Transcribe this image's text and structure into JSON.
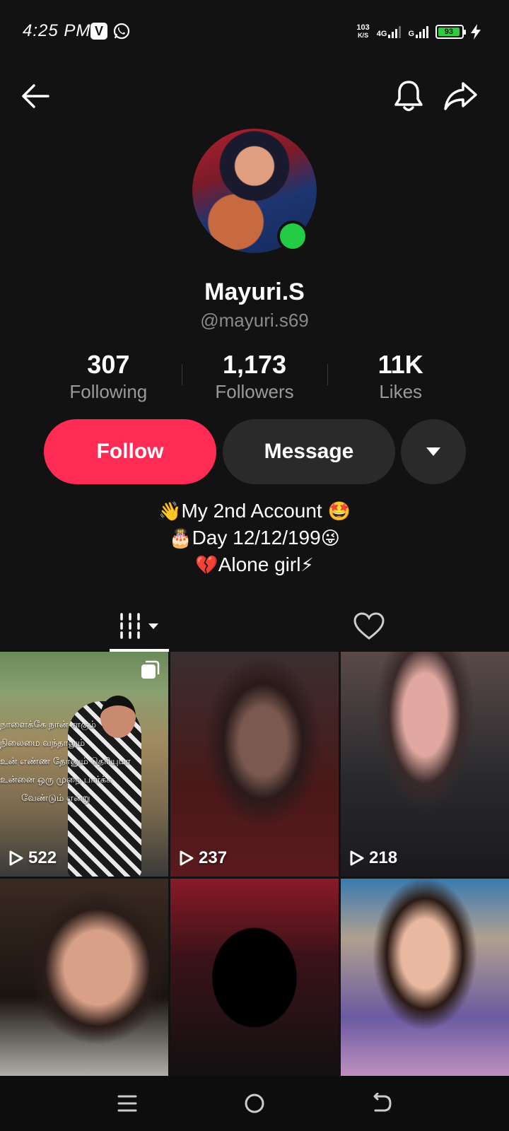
{
  "status_bar": {
    "time": "4:25 PM",
    "app_icon_letter": "V",
    "net_speed_value": "103",
    "net_speed_unit": "K/S",
    "network_1": "4G",
    "network_2": "G",
    "battery": "93",
    "battery_fill_percent": 93
  },
  "profile": {
    "display_name": "Mayuri.S",
    "username": "@mayuri.s69",
    "online": true
  },
  "stats": {
    "following_count": "307",
    "following_label": "Following",
    "followers_count": "1,173",
    "followers_label": "Followers",
    "likes_count": "11K",
    "likes_label": "Likes"
  },
  "actions": {
    "follow_label": "Follow",
    "message_label": "Message"
  },
  "bio": {
    "line1": "My 2nd Account",
    "line2": "Day 12/12/199",
    "line3": "Alone girl"
  },
  "bio_emojis": {
    "line1_prefix": "👋",
    "line1_suffix": "🤩",
    "line2_prefix": "🎂",
    "line2_suffix": "😜",
    "line3_prefix": "💔",
    "line3_suffix": "⚡"
  },
  "overlay_text": {
    "line1": "நாளைக்கே நான் சாகும்",
    "line2": "நிலைமை வந்தாலும்",
    "line3": "உன் எண்ண தோனும் தெரியுமா",
    "line4": "உன்னை ஒரு முறை பார்க்க",
    "line5": "வேண்டும் என்று"
  },
  "videos": [
    {
      "views": "522"
    },
    {
      "views": "237"
    },
    {
      "views": "218"
    },
    {
      "views": ""
    },
    {
      "views": ""
    },
    {
      "views": ""
    }
  ],
  "colors": {
    "background": "#121212",
    "follow_accent": "#fe2c55",
    "secondary_button": "#2a2a2a",
    "online": "#22cc44",
    "battery": "#2ecc40"
  }
}
